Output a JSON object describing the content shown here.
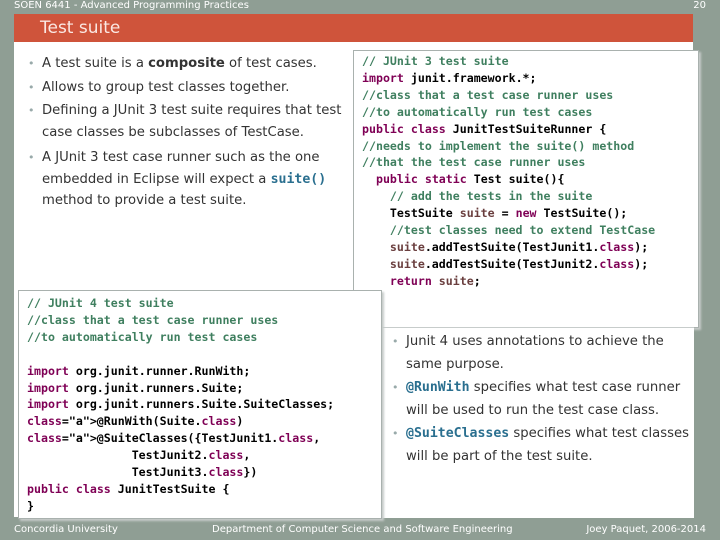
{
  "header": {
    "course": "SOEN 6441 - Advanced Programming Practices",
    "page_number": "20",
    "title": "Test suite"
  },
  "left_bullets": [
    {
      "pre": "A test suite is a ",
      "bold": "composite",
      "post": " of test cases."
    },
    {
      "text": "Allows to group test classes together."
    },
    {
      "text": "Defining a JUnit 3 test suite requires that test case classes be subclasses of TestCase."
    },
    {
      "pre": "A JUnit 3 test case runner such as the one embedded in Eclipse will expect a ",
      "code": "suite()",
      "post": " method to provide a test suite."
    }
  ],
  "junit3_code": [
    "// JUnit 3 test suite",
    "import junit.framework.*;",
    "//class that a test case runner uses",
    "//to automatically run test cases",
    "public class JunitTestSuiteRunner {",
    "//needs to implement the suite() method",
    "//that the test case runner uses",
    "  public static Test suite(){",
    "    // add the tests in the suite",
    "    TestSuite suite = new TestSuite();",
    "    //test classes need to extend TestCase",
    "    suite.addTestSuite(TestJunit1.class);",
    "    suite.addTestSuite(TestJunit2.class);",
    "    return suite;",
    "  }"
  ],
  "junit4_code": [
    "// JUnit 4 test suite",
    "//class that a test case runner uses",
    "//to automatically run test cases",
    "",
    "import org.junit.runner.RunWith;",
    "import org.junit.runners.Suite;",
    "import org.junit.runners.Suite.SuiteClasses;",
    "@RunWith(Suite.class)",
    "@SuiteClasses({TestJunit1.class,",
    "               TestJunit2.class,",
    "               TestJunit3.class})",
    "public class JunitTestSuite {",
    "}"
  ],
  "right_bullets": [
    {
      "text": "Junit 4 uses annotations to achieve the same purpose."
    },
    {
      "code": "@RunWith",
      "post": " specifies what test case runner will be used to run the test case class."
    },
    {
      "code": "@SuiteClasses",
      "post": " specifies what test classes will be part of the test suite."
    }
  ],
  "footer": {
    "left": "Concordia University",
    "center": "Department of Computer Science and Software Engineering",
    "right": "Joey Paquet, 2006-2014"
  },
  "colors": {
    "title_bar": "#cf543b",
    "background": "#8f9e94",
    "code_highlight": "#2a6f8f"
  }
}
